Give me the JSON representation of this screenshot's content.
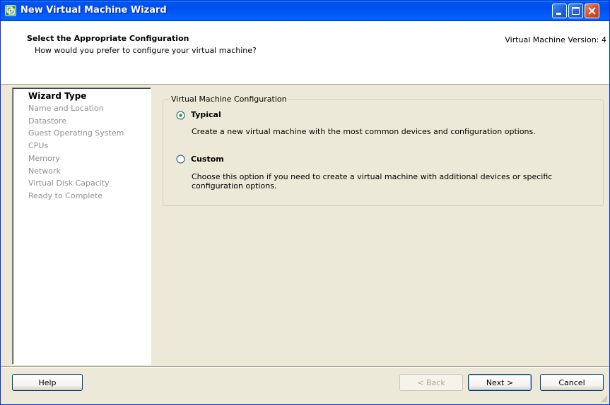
{
  "window": {
    "title": "New Virtual Machine Wizard",
    "icon": "vm-wizard-icon"
  },
  "header": {
    "title": "Select the Appropriate Configuration",
    "subtitle": "How would you prefer to configure your virtual machine?",
    "version": "Virtual Machine Version: 4"
  },
  "steps": [
    {
      "label": "Wizard Type",
      "active": true
    },
    {
      "label": "Name and Location",
      "active": false
    },
    {
      "label": "Datastore",
      "active": false
    },
    {
      "label": "Guest Operating System",
      "active": false
    },
    {
      "label": "CPUs",
      "active": false
    },
    {
      "label": "Memory",
      "active": false
    },
    {
      "label": "Network",
      "active": false
    },
    {
      "label": "Virtual Disk Capacity",
      "active": false
    },
    {
      "label": "Ready to Complete",
      "active": false
    }
  ],
  "config": {
    "group_label": "Virtual Machine Configuration",
    "options": [
      {
        "label": "Typical",
        "selected": true,
        "description": "Create a new virtual machine with the most common devices and configuration options."
      },
      {
        "label": "Custom",
        "selected": false,
        "description": "Choose this option if you need to create a virtual machine with additional devices or specific configuration options."
      }
    ]
  },
  "buttons": {
    "help": "Help",
    "back": "< Back",
    "next": "Next >",
    "cancel": "Cancel"
  },
  "colors": {
    "titlebar": "#0054E3",
    "dialog_bg": "#ECE9D8",
    "disabled_text": "#8E8E8E"
  }
}
